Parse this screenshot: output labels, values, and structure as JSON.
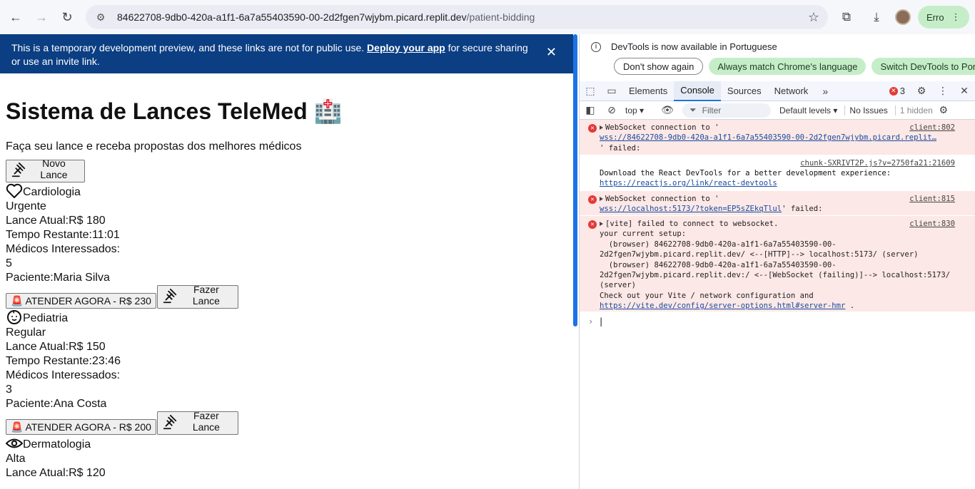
{
  "browser": {
    "url_host": "84622708-9db0-420a-a1f1-6a7a55403590-00-2d2fgen7wjybm.picard.replit.dev",
    "url_path": "/patient-bidding",
    "profile_label": "Erro"
  },
  "banner": {
    "text": "This is a temporary development preview, and these links are not for public use.",
    "link": "Deploy your app",
    "text_after": "for secure sharing or use an invite link."
  },
  "page": {
    "title": "Sistema de Lances TeleMed",
    "title_emoji": "🏥",
    "subtitle": "Faça seu lance e receba propostas dos melhores médicos",
    "new_bid_label": "Novo Lance",
    "cards": [
      {
        "specialty": "Cardiologia",
        "icon": "heart-icon",
        "priority": "Urgente",
        "current_bid_label": "Lance Atual:",
        "current_bid": "R$ 180",
        "time_label": "Tempo Restante:",
        "time_left": "11:01",
        "doctors_label": "Médicos Interessados:",
        "doctors": "5",
        "patient_label": "Paciente:",
        "patient": "Maria Silva",
        "attend_label": "🚨 ATENDER AGORA - R$ 230",
        "bid_label": "Fazer Lance"
      },
      {
        "specialty": "Pediatria",
        "icon": "baby-face-icon",
        "priority": "Regular",
        "current_bid_label": "Lance Atual:",
        "current_bid": "R$ 150",
        "time_label": "Tempo Restante:",
        "time_left": "23:46",
        "doctors_label": "Médicos Interessados:",
        "doctors": "3",
        "patient_label": "Paciente:",
        "patient": "Ana Costa",
        "attend_label": "🚨 ATENDER AGORA - R$ 200",
        "bid_label": "Fazer Lance"
      },
      {
        "specialty": "Dermatologia",
        "icon": "eye-icon",
        "priority": "Alta",
        "current_bid_label": "Lance Atual:",
        "current_bid": "R$ 120"
      }
    ]
  },
  "devtools": {
    "notice": "DevTools is now available in Portuguese",
    "btn_dont_show": "Don't show again",
    "btn_match": "Always match Chrome's language",
    "btn_switch": "Switch DevTools to Portuguese",
    "tabs": [
      "Elements",
      "Console",
      "Sources",
      "Network"
    ],
    "active_tab": "Console",
    "error_count": "3",
    "context": "top ▾",
    "filter_placeholder": "Filter",
    "levels": "Default levels ▾",
    "issues": "No Issues",
    "hidden": "1 hidden",
    "messages": [
      {
        "type": "error",
        "line1": "WebSocket connection to '",
        "link": "wss://84622708-9db0-420a-a1f1-6a7a55403590-00-2d2fgen7wjybm.picard.replit…",
        "line3": "' failed:",
        "source": "client:802"
      },
      {
        "type": "info",
        "source": "chunk-SXRIVT2P.js?v=2750fa21:21609",
        "line1": "Download the React DevTools for a better development experience:",
        "link": "https://reactjs.org/link/react-devtools"
      },
      {
        "type": "error",
        "line1": "WebSocket connection to '",
        "link": "wss://localhost:5173/?token=EP5sZEkqTlul",
        "line2": "' failed:",
        "source": "client:815"
      },
      {
        "type": "error",
        "source": "client:830",
        "line1": "[vite] failed to connect to websocket.",
        "line2": "your current setup:",
        "line3": "  (browser) 84622708-9db0-420a-a1f1-6a7a55403590-00-2d2fgen7wjybm.picard.replit.dev/ <--[HTTP]--> localhost:5173/ (server)",
        "line4": "  (browser) 84622708-9db0-420a-a1f1-6a7a55403590-00-2d2fgen7wjybm.picard.replit.dev:/ <--[WebSocket (failing)]--> localhost:5173/ (server)",
        "line5": "Check out your Vite / network configuration and",
        "link": "https://vite.dev/config/server-options.html#server-hmr",
        "tail": " ."
      }
    ]
  }
}
